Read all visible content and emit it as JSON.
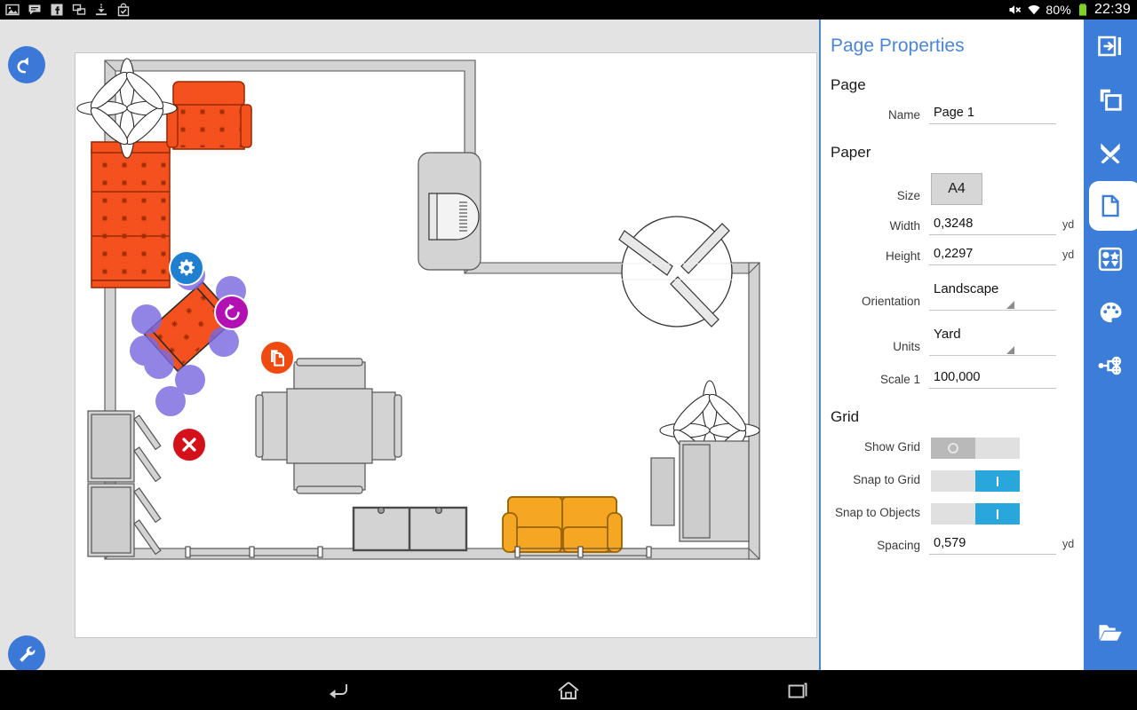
{
  "statusbar": {
    "left_icons": [
      "gallery-icon",
      "message-icon",
      "facebook-icon",
      "multi-window-icon",
      "download-icon",
      "shopping-bag-check-icon"
    ],
    "mute_icon": "sound-muted-icon",
    "wifi_icon": "wifi-icon",
    "battery_percent": "80%",
    "battery_icon": "battery-icon",
    "clock": "22:39"
  },
  "canvas": {
    "undo_button": "undo-button",
    "wrench_button": "settings-wrench-button",
    "selection": {
      "settings_button": "object-settings-button",
      "rotate_button": "object-rotate-button",
      "duplicate_button": "object-duplicate-button",
      "delete_button": "object-delete-button"
    }
  },
  "panel": {
    "title": "Page Properties",
    "sections": {
      "page": "Page",
      "paper": "Paper",
      "grid": "Grid"
    },
    "fields": {
      "name_label": "Name",
      "name_value": "Page 1",
      "size_label": "Size",
      "size_value": "A4",
      "width_label": "Width",
      "width_value": "0,3248",
      "width_unit": "yd",
      "height_label": "Height",
      "height_value": "0,2297",
      "height_unit": "yd",
      "orientation_label": "Orientation",
      "orientation_value": "Landscape",
      "units_label": "Units",
      "units_value": "Yard",
      "scale_label": "Scale 1",
      "scale_value": "100,000",
      "show_grid_label": "Show Grid",
      "show_grid_state": "off",
      "snap_grid_label": "Snap to Grid",
      "snap_grid_state": "on",
      "snap_objects_label": "Snap to Objects",
      "snap_objects_state": "on",
      "spacing_label": "Spacing",
      "spacing_value": "0,579",
      "spacing_unit": "yd"
    }
  },
  "rail": {
    "items": [
      {
        "name": "export-arrow-icon",
        "label": "Export"
      },
      {
        "name": "layers-icon",
        "label": "Layers"
      },
      {
        "name": "tools-icon",
        "label": "Tools"
      },
      {
        "name": "document-icon",
        "label": "Page",
        "active": true
      },
      {
        "name": "shapes-icon",
        "label": "Shapes"
      },
      {
        "name": "palette-icon",
        "label": "Style"
      },
      {
        "name": "connectors-icon",
        "label": "Connectors"
      }
    ],
    "bottom_item": {
      "name": "open-folder-icon",
      "label": "Open"
    }
  },
  "navbar": {
    "back": "back-icon",
    "home": "home-icon",
    "recents": "recents-icon"
  },
  "colors": {
    "accent_blue": "#3b7dd8",
    "title_blue": "#4a86d8",
    "toggle_on": "#29a7dd",
    "rotate_purple": "#b310b3",
    "duplicate_orange": "#ef4b10",
    "delete_red": "#d4111b",
    "furniture_orange": "#f4511e",
    "furniture_amber": "#f5a623",
    "handle_purple": "#7b6ae0"
  }
}
